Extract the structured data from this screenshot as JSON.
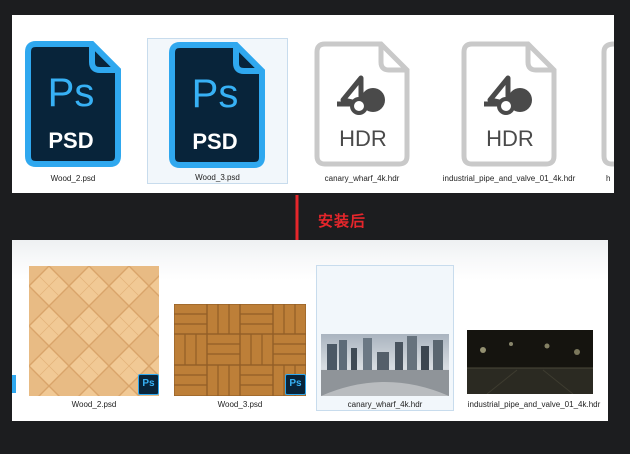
{
  "top_files": [
    {
      "name": "Wood_2.psd",
      "type_label": "Ps",
      "ext_label": "PSD"
    },
    {
      "name": "Wood_3.psd",
      "type_label": "Ps",
      "ext_label": "PSD"
    },
    {
      "name": "canary_wharf_4k.hdr",
      "ext_label": "HDR"
    },
    {
      "name": "industrial_pipe_and_valve_01_4k.hdr",
      "ext_label": "HDR"
    },
    {
      "name": "h"
    }
  ],
  "caption": "安装后",
  "bottom_files": [
    {
      "name": "Wood_2.psd",
      "badge": "Ps"
    },
    {
      "name": "Wood_3.psd",
      "badge": "Ps"
    },
    {
      "name": "canary_wharf_4k.hdr"
    },
    {
      "name": "industrial_pipe_and_valve_01_4k.hdr"
    }
  ],
  "colors": {
    "ps_dark": "#08243a",
    "ps_blue": "#2fa8ef",
    "hdr_gray": "#4a4a4a",
    "caption_red": "#e5262b"
  }
}
